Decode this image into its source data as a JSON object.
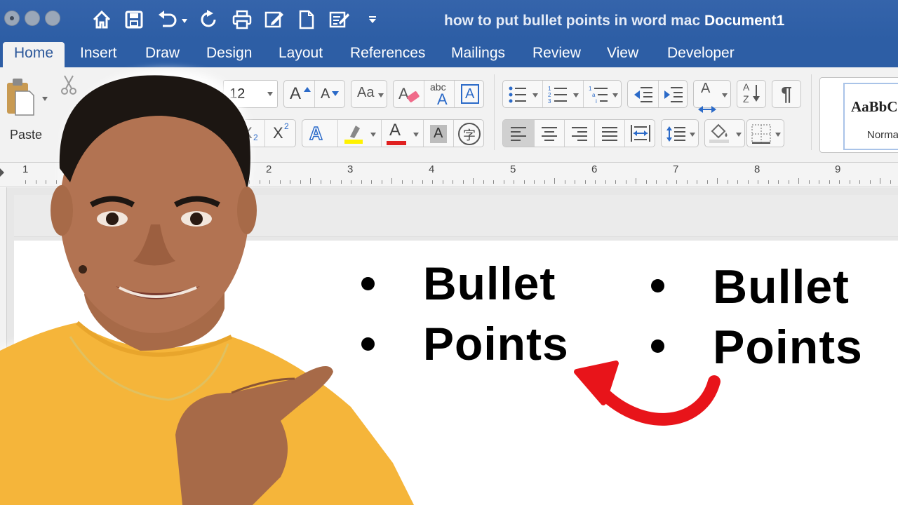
{
  "window": {
    "title": "how to put bullet points in word mac",
    "document_name": "Document1"
  },
  "quick_access": {
    "icons": [
      "home-icon",
      "save-icon",
      "undo-icon",
      "redo-icon",
      "print-icon",
      "edit-icon",
      "new-document-icon",
      "checklist-icon",
      "customize-toolbar-icon"
    ]
  },
  "tabs": [
    {
      "label": "Home",
      "active": true
    },
    {
      "label": "Insert"
    },
    {
      "label": "Draw"
    },
    {
      "label": "Design"
    },
    {
      "label": "Layout"
    },
    {
      "label": "References"
    },
    {
      "label": "Mailings"
    },
    {
      "label": "Review"
    },
    {
      "label": "View"
    },
    {
      "label": "Developer"
    }
  ],
  "ribbon": {
    "paste_label": "Paste",
    "font_size": "12",
    "grow_font": "A",
    "shrink_font": "A",
    "change_case": "Aa",
    "spelling": "abc",
    "spelling_sub": "A",
    "text_box": "A",
    "subscript": "X",
    "subscript_sub": "2",
    "superscript": "X",
    "superscript_sup": "2",
    "text_effects": "A",
    "font_color": "A",
    "char_shading": "A",
    "phonetic": "字",
    "sort_letters": "A",
    "sort_letters2": "Z",
    "pilcrow": "¶",
    "style_sample": "AaBbCcDd",
    "style_name": "Normal",
    "colors": {
      "highlight": "#fff200",
      "font_color": "#e02020"
    }
  },
  "ruler": {
    "numbers": [
      "1",
      "2",
      "3",
      "4",
      "5",
      "6",
      "7",
      "8",
      "9"
    ]
  },
  "document": {
    "list_left": [
      "Bullet",
      "Points"
    ],
    "list_right": [
      "Bullet",
      "Points"
    ]
  },
  "overlay": {
    "arrow_color": "#e8141a"
  }
}
